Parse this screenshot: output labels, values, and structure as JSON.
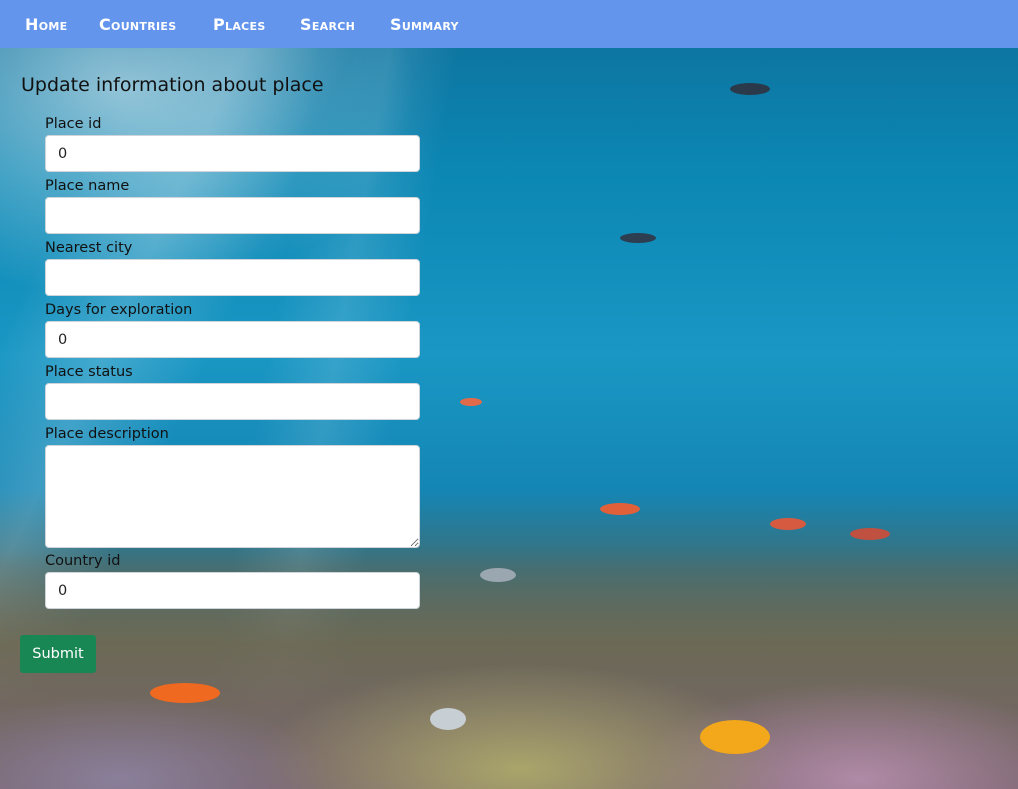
{
  "nav": {
    "items": [
      "Home",
      "Countries",
      "Places",
      "Search",
      "Summary"
    ]
  },
  "form": {
    "title": "Update information about place",
    "fields": {
      "place_id": {
        "label": "Place id",
        "value": "0"
      },
      "place_name": {
        "label": "Place name",
        "value": ""
      },
      "nearest_city": {
        "label": "Nearest city",
        "value": ""
      },
      "days_for_exploration": {
        "label": "Days for exploration",
        "value": "0"
      },
      "place_status": {
        "label": "Place status",
        "value": ""
      },
      "place_description": {
        "label": "Place description",
        "value": ""
      },
      "country_id": {
        "label": "Country id",
        "value": "0"
      }
    },
    "submit_label": "Submit"
  },
  "colors": {
    "nav_bg": "#6495ed",
    "submit_bg": "#198754"
  }
}
